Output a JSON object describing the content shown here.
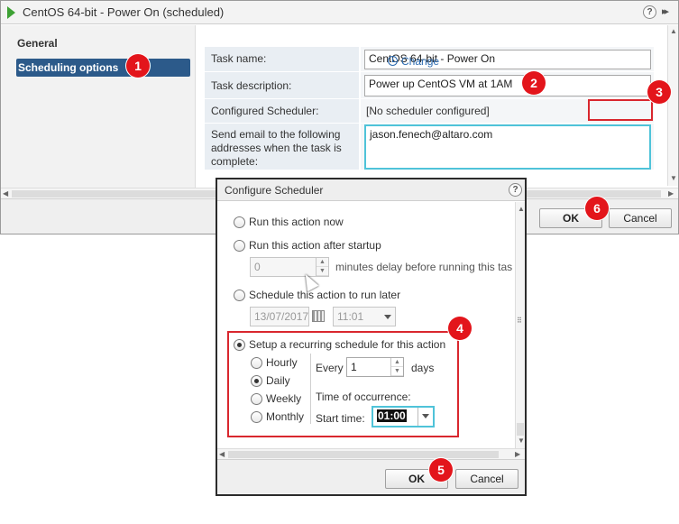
{
  "window": {
    "title": "CentOS 64-bit - Power On (scheduled)",
    "help_glyph": "?",
    "expand_glyph": "▸▸"
  },
  "nav": {
    "items": [
      {
        "label": "General",
        "selected": false
      },
      {
        "label": "Scheduling options",
        "selected": true
      }
    ]
  },
  "form": {
    "task_name_label": "Task name:",
    "task_name_value": "CentOS 64-bit - Power On",
    "task_desc_label": "Task description:",
    "task_desc_value": "Power up CentOS VM at 1AM",
    "scheduler_label": "Configured Scheduler:",
    "scheduler_value": "[No scheduler configured]",
    "change_label": "Change",
    "email_label": "Send email to the following addresses when the task is complete:",
    "email_value": "jason.fenech@altaro.com"
  },
  "footer": {
    "ok_label": "OK",
    "cancel_label": "Cancel"
  },
  "dialog": {
    "title": "Configure Scheduler",
    "help_glyph": "?",
    "opt_now": "Run this action now",
    "opt_startup": "Run this action after startup",
    "delay_value": "0",
    "delay_suffix": "minutes delay before running this tas",
    "opt_later": "Schedule this action to run later",
    "date_value": "13/07/2017",
    "time_value": "11:01",
    "opt_recurring": "Setup a recurring schedule for this action",
    "freq_hourly": "Hourly",
    "freq_daily": "Daily",
    "freq_weekly": "Weekly",
    "freq_monthly": "Monthly",
    "every_label": "Every",
    "every_value": "1",
    "days_label": "days",
    "occurrence_label": "Time of occurrence:",
    "start_time_label": "Start time:",
    "start_time_value": "01:00",
    "ok_label": "OK",
    "cancel_label": "Cancel"
  },
  "callouts": [
    "1",
    "2",
    "3",
    "4",
    "5",
    "6"
  ],
  "colors": {
    "highlight": "#d9272e",
    "accent": "#2c5a8a",
    "focus": "#4fc3d9",
    "link": "#2a6ab0"
  }
}
